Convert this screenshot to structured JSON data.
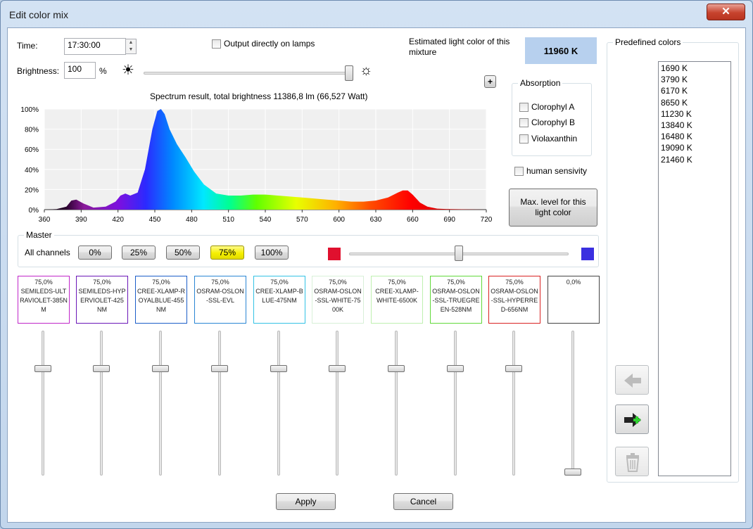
{
  "window": {
    "title": "Edit color mix",
    "close_label": "✕"
  },
  "controls": {
    "time_label": "Time:",
    "time_value": "17:30:00",
    "output_label": "Output directly on lamps",
    "estimated_label": "Estimated light color of this mixture",
    "estimated_value": "11960 K",
    "brightness_label": "Brightness:",
    "brightness_value": "100",
    "brightness_unit": "%",
    "brightness_level": 1.0,
    "plus_label": "+"
  },
  "absorption": {
    "legend": "Absorption",
    "items": [
      "Clorophyl A",
      "Clorophyl B",
      "Violaxanthin"
    ]
  },
  "human_sensitivity_label": "human sensivity",
  "max_level_button": "Max. level for this light color",
  "spectrum": {
    "title": "Spectrum result, total brightness 11386,8 lm (66,527 Watt)"
  },
  "chart_data": {
    "type": "area",
    "title": "Spectrum result, total brightness 11386,8 lm (66,527 Watt)",
    "xlabel": "",
    "ylabel": "",
    "xlim": [
      360,
      720
    ],
    "ylim": [
      0,
      100
    ],
    "x_ticks": [
      360,
      390,
      420,
      450,
      480,
      510,
      540,
      570,
      600,
      630,
      660,
      690,
      720
    ],
    "y_ticks": [
      "0%",
      "20%",
      "40%",
      "60%",
      "80%",
      "100%"
    ],
    "grid": true,
    "x": [
      360,
      370,
      378,
      382,
      386,
      392,
      400,
      410,
      418,
      422,
      426,
      430,
      436,
      442,
      448,
      452,
      455,
      458,
      462,
      468,
      475,
      482,
      490,
      500,
      510,
      520,
      530,
      540,
      550,
      560,
      570,
      580,
      590,
      600,
      610,
      620,
      630,
      640,
      648,
      652,
      656,
      660,
      666,
      672,
      680,
      690,
      720
    ],
    "y": [
      0,
      0.5,
      3,
      9,
      10,
      6,
      2,
      3,
      8,
      14,
      16,
      14,
      17,
      40,
      80,
      98,
      100,
      95,
      80,
      65,
      52,
      38,
      25,
      16,
      14,
      14,
      15,
      15,
      14,
      13,
      12,
      11,
      10,
      9,
      8,
      8,
      9,
      12,
      17,
      19,
      19,
      15,
      7,
      3,
      1,
      0.5,
      0
    ]
  },
  "master": {
    "legend": "Master",
    "all_channels_label": "All channels",
    "buttons": [
      "0%",
      "25%",
      "50%",
      "75%",
      "100%"
    ],
    "active": "75%",
    "slider_level": 0.5,
    "colors": {
      "left": "#e0102e",
      "right": "#3a2fe0"
    }
  },
  "channels": [
    {
      "pct": "75,0%",
      "name": "SEMILEDS-ULTRAVIOLET-385NM",
      "color": "#c026c9",
      "level": 0.75
    },
    {
      "pct": "75,0%",
      "name": "SEMILEDS-HYPERVIOLET-425NM",
      "color": "#6a16b7",
      "level": 0.75
    },
    {
      "pct": "75,0%",
      "name": "CREE-XLAMP-ROYALBLUE-455NM",
      "color": "#1c5ec8",
      "level": 0.75
    },
    {
      "pct": "75,0%",
      "name": "OSRAM-OSLON-SSL-EVL",
      "color": "#2a86d4",
      "level": 0.75
    },
    {
      "pct": "75,0%",
      "name": "CREE-XLAMP-BLUE-475NM",
      "color": "#33c2e5",
      "level": 0.75
    },
    {
      "pct": "75,0%",
      "name": "OSRAM-OSLON-SSL-WHITE-7500K",
      "color": "#d8f0d8",
      "level": 0.75
    },
    {
      "pct": "75,0%",
      "name": "CREE-XLAMP-WHITE-6500K",
      "color": "#bff0b0",
      "level": 0.75
    },
    {
      "pct": "75,0%",
      "name": "OSRAM-OSLON-SSL-TRUEGREEN-528NM",
      "color": "#61d93a",
      "level": 0.75
    },
    {
      "pct": "75,0%",
      "name": "OSRAM-OSLON-SSL-HYPERRED-656NM",
      "color": "#d92222",
      "level": 0.75
    },
    {
      "pct": "0,0%",
      "name": "",
      "color": "#444444",
      "level": 0.0
    }
  ],
  "predefined": {
    "legend": "Predefined colors",
    "items": [
      "1690 K",
      "3790 K",
      "6170 K",
      "8650 K",
      "11230 K",
      "13840 K",
      "16480 K",
      "19090 K",
      "21460 K"
    ]
  },
  "side_buttons": {
    "load": "arrow-left-icon",
    "save": "arrow-right-add-icon",
    "delete": "trash-icon"
  },
  "footer": {
    "apply": "Apply",
    "cancel": "Cancel"
  }
}
